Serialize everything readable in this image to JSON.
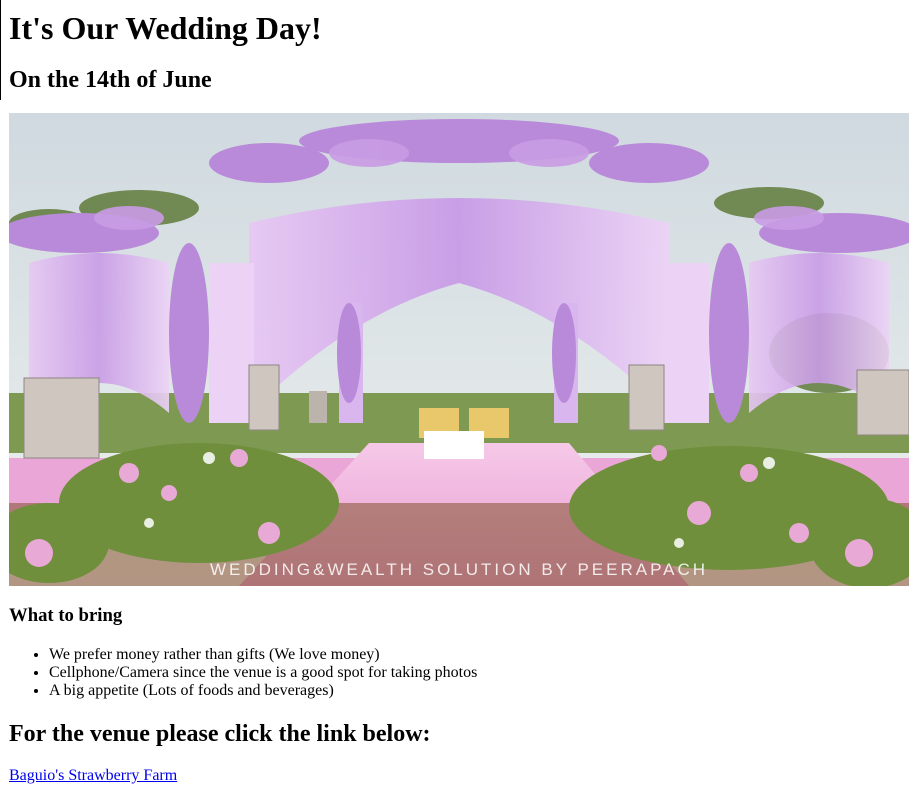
{
  "title": "It's Our Wedding Day!",
  "date": "On the 14th of June",
  "hero_image": {
    "watermark": "WEDDING&WEALTH SOLUTION BY PEERAPACH",
    "palette": {
      "sky": "#dfe6ea",
      "drape": "#d9b6ee",
      "flower": "#b98ad9",
      "carpet": "#f3b8e0",
      "foliage": "#6f8f3c"
    }
  },
  "bring": {
    "heading": "What to bring",
    "items": [
      "We prefer money rather than gifts (We love money)",
      "Cellphone/Camera since the venue is a good spot for taking photos",
      "A big appetite (Lots of foods and beverages)"
    ]
  },
  "venue": {
    "heading": "For the venue please click the link below:",
    "link_text": "Baguio's Strawberry Farm"
  }
}
